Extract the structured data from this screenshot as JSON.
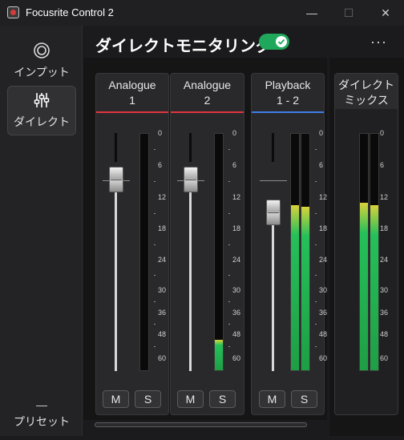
{
  "window": {
    "title": "Focusrite Control 2",
    "minimize_glyph": "—",
    "maximize_glyph": "☐",
    "close_glyph": "✕"
  },
  "sidebar": {
    "items": [
      {
        "label": "インプット",
        "icon": "input-ring-icon"
      },
      {
        "label": "ダイレクト",
        "icon": "sliders-icon"
      },
      {
        "label": "プリセット",
        "icon": "dash-icon",
        "icon_glyph": "—"
      }
    ]
  },
  "header": {
    "title": "ダイレクトモニタリング",
    "toggle_on": true,
    "more_glyph": "···"
  },
  "meter_scale": [
    "0",
    "6",
    "12",
    "18",
    "24",
    "30",
    "36",
    "48",
    "60"
  ],
  "channels": [
    {
      "line1": "Analogue",
      "line2": "1",
      "accent": "#e0353e",
      "fader_db": -6,
      "meter_levels": [
        0
      ],
      "mute_label": "M",
      "solo_label": "S"
    },
    {
      "line1": "Analogue",
      "line2": "2",
      "accent": "#e0353e",
      "fader_db": -6,
      "meter_levels": [
        0.13
      ],
      "mute_label": "M",
      "solo_label": "S"
    },
    {
      "line1": "Playback",
      "line2": "1 - 2",
      "accent": "#3f7ee8",
      "fader_db": -16,
      "meter_levels": [
        0.7,
        0.69
      ],
      "mute_label": "M",
      "solo_label": "S"
    }
  ],
  "mix": {
    "line1": "ダイレクト",
    "line2": "ミックス",
    "meter_levels": [
      0.71,
      0.7
    ]
  },
  "colors": {
    "toggle_on": "#1fa85b",
    "meter_green": "#25c05a",
    "analogue_accent": "#e0353e",
    "playback_accent": "#3f7ee8"
  }
}
